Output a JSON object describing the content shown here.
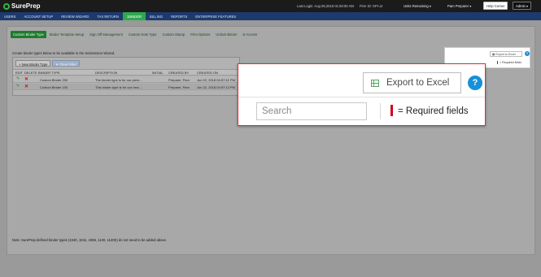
{
  "header": {
    "logo": "SurePrep",
    "last_login": "Last Login: Aug 06,2018 01:50:00 AM",
    "firm_id": "Firm ID: SPI-JJ",
    "units": "Units Remaining",
    "user": "Pam Preparer",
    "help_center": "Help Center",
    "admin": "Admin"
  },
  "nav": {
    "items": [
      "USERS",
      "ACCOUNT SETUP",
      "REVIEW WIZARD",
      "TAX RETURN",
      "1BINDER",
      "BILLING",
      "REPORTS",
      "ENTERPRISE FEATURES"
    ],
    "active": "1BINDER"
  },
  "subtabs": [
    "Custom Binder Type",
    "Binder Template Setup",
    "Sign Off Management",
    "Custom Note Type",
    "Custom Stamp",
    "Print Options",
    "Unlock Binder",
    "E-Access"
  ],
  "instructions": "Create binder types below to be available in the Submission Wizard.",
  "table": {
    "new_button": "New Binder Type",
    "clear_button": "Clear Filter",
    "columns": [
      "EDIT",
      "DELETE",
      "BINDER TYPE",
      "DESCRIPTION",
      "INITIAL",
      "CREATED BY",
      "CREATED ON"
    ],
    "rows": [
      {
        "binder_type": "Custom Binder 200",
        "description": "The binder type is for our previ...",
        "created_by": "Preparer, Pam",
        "created_on": "Jun 22, 2018 04:57:41 PM"
      },
      {
        "binder_type": "Custom Binder 100",
        "description": "This binder type is for our new ...",
        "created_by": "Preparer, Pam",
        "created_on": "Jun 22, 2018 04:57:12 PM"
      }
    ]
  },
  "note": "Note: SurePrep defined binder types (1040, 1041, 1065, 1120, 1120S) do not need to be added above.",
  "toolbar": {
    "export_label": "Export to Excel",
    "help_symbol": "?",
    "search_placeholder": "Search",
    "required_label": "= Required fields",
    "mini_required_label": "= Required fields"
  },
  "colors": {
    "nav_bg": "#1d3a6e",
    "nav_active": "#2fa84f",
    "required_red": "#d0021b",
    "help_blue": "#1790d9",
    "callout_border": "#d8323a"
  }
}
